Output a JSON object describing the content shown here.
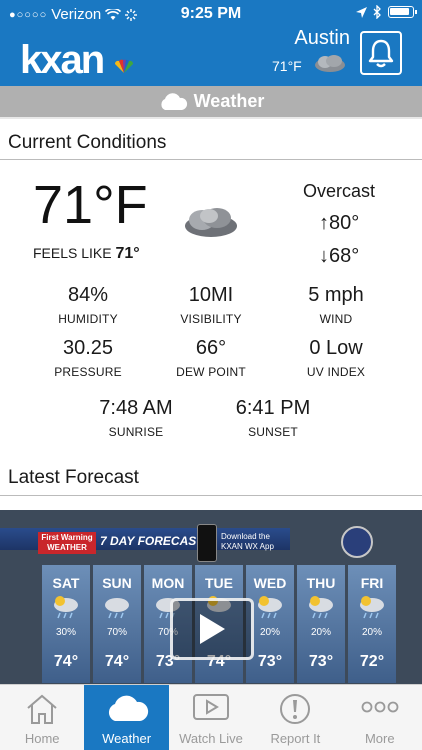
{
  "status_bar": {
    "signal": "●○○○○",
    "carrier": "Verizon",
    "time": "9:25 PM"
  },
  "header": {
    "logo": "kxan",
    "city": "Austin",
    "temp": "71°F",
    "brand_color": "#1a78c2"
  },
  "section": {
    "label": "Weather",
    "icon": "cloud-icon"
  },
  "current": {
    "title": "Current Conditions",
    "temp": "71°F",
    "feels_like_label": "FEELS LIKE",
    "feels_like_value": "71°",
    "condition": "Overcast",
    "high": "↑80°",
    "low": "↓68°",
    "stats": {
      "humidity": {
        "value": "84%",
        "label": "HUMIDITY"
      },
      "visibility": {
        "value": "10MI",
        "label": "VISIBILITY"
      },
      "wind": {
        "value": "5 mph",
        "label": "WIND"
      },
      "pressure": {
        "value": "30.25",
        "label": "PRESSURE"
      },
      "dew_point": {
        "value": "66°",
        "label": "DEW POINT"
      },
      "uv_index": {
        "value": "0 Low",
        "label": "UV INDEX"
      },
      "sunrise": {
        "value": "7:48 AM",
        "label": "SUNRISE"
      },
      "sunset": {
        "value": "6:41 PM",
        "label": "SUNSET"
      }
    }
  },
  "forecast": {
    "title": "Latest Forecast",
    "video": {
      "banner_tag": "First Warning WEATHER",
      "banner_title": "7 DAY FORECAST",
      "download_text": "Download the KXAN WX App",
      "days": [
        {
          "day": "SAT",
          "precip": "30%",
          "temp": "74°"
        },
        {
          "day": "SUN",
          "precip": "70%",
          "temp": "74°"
        },
        {
          "day": "MON",
          "precip": "70%",
          "temp": "73°"
        },
        {
          "day": "TUE",
          "precip": "",
          "temp": "74°"
        },
        {
          "day": "WED",
          "precip": "20%",
          "temp": "73°"
        },
        {
          "day": "THU",
          "precip": "20%",
          "temp": "73°"
        },
        {
          "day": "FRI",
          "precip": "20%",
          "temp": "72°"
        }
      ]
    }
  },
  "tabs": [
    {
      "label": "Home",
      "icon": "home-icon"
    },
    {
      "label": "Weather",
      "icon": "cloud-icon",
      "active": true
    },
    {
      "label": "Watch Live",
      "icon": "play-icon"
    },
    {
      "label": "Report It",
      "icon": "alert-icon"
    },
    {
      "label": "More",
      "icon": "more-icon"
    }
  ]
}
